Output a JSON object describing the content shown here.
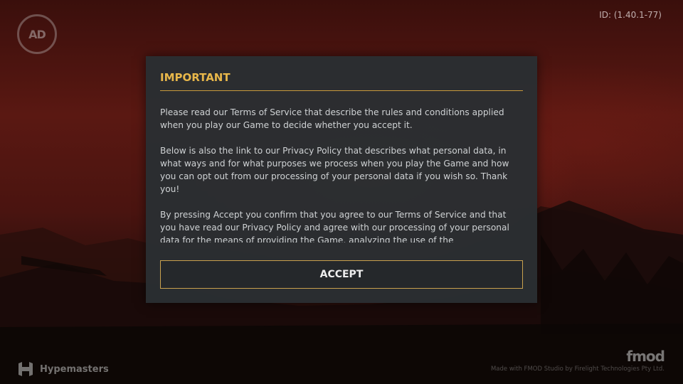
{
  "build_id": "ID: (1.40.1-77)",
  "studio_badge": "AD",
  "dialog": {
    "title": "IMPORTANT",
    "paragraphs": [
      "Please read our Terms of Service that describe the rules and conditions applied when you play our Game to decide whether you accept it.",
      "Below is also the link to our Privacy Policy that describes what personal data, in what ways and for what purposes we process when you play the Game and how you can opt out from our processing of your personal data if you wish so. Thank you!",
      "By pressing  Accept  you confirm that you agree to our Terms of Service and that you have read our Privacy Policy and agree with our processing of your personal data for the means of providing the Game, analyzing the use of the"
    ],
    "accept_label": "ACCEPT"
  },
  "footer": {
    "publisher": "Hypemasters",
    "fmod_logo": "fmod",
    "fmod_credit": "Made with FMOD Studio by Firelight Technologies Pty Ltd."
  },
  "colors": {
    "accent": "#e8b74a",
    "dialog_bg": "#2a2e32",
    "button_border": "#c9a14e"
  }
}
